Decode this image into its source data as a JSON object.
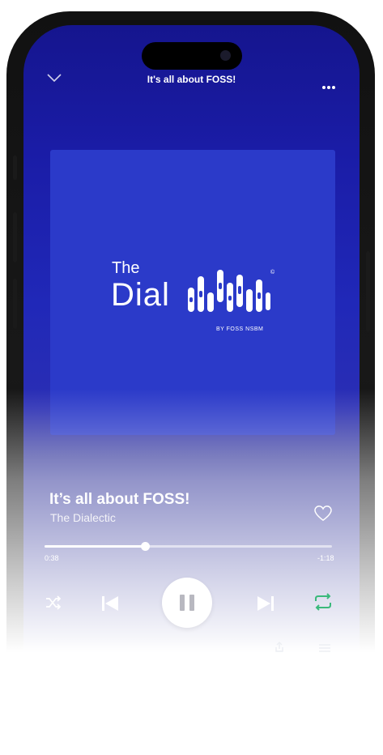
{
  "header": {
    "title": "It's all about FOSS!"
  },
  "artwork": {
    "logo_the": "The",
    "logo_main": "Dial",
    "logo_byline": "BY FOSS NSBM",
    "logo_mark": "©",
    "background": "#2b3ac9"
  },
  "track": {
    "title": "It’s all about FOSS!",
    "artist": "The Dialectic",
    "elapsed": "0:38",
    "remaining": "-1:18",
    "progress": 0.35
  },
  "controls": [
    "shuffle-icon",
    "previous-icon",
    "pause-icon",
    "next-icon",
    "repeat-icon"
  ],
  "colors": {
    "screen": "#1a1ca6",
    "accent": "#ffffff"
  }
}
